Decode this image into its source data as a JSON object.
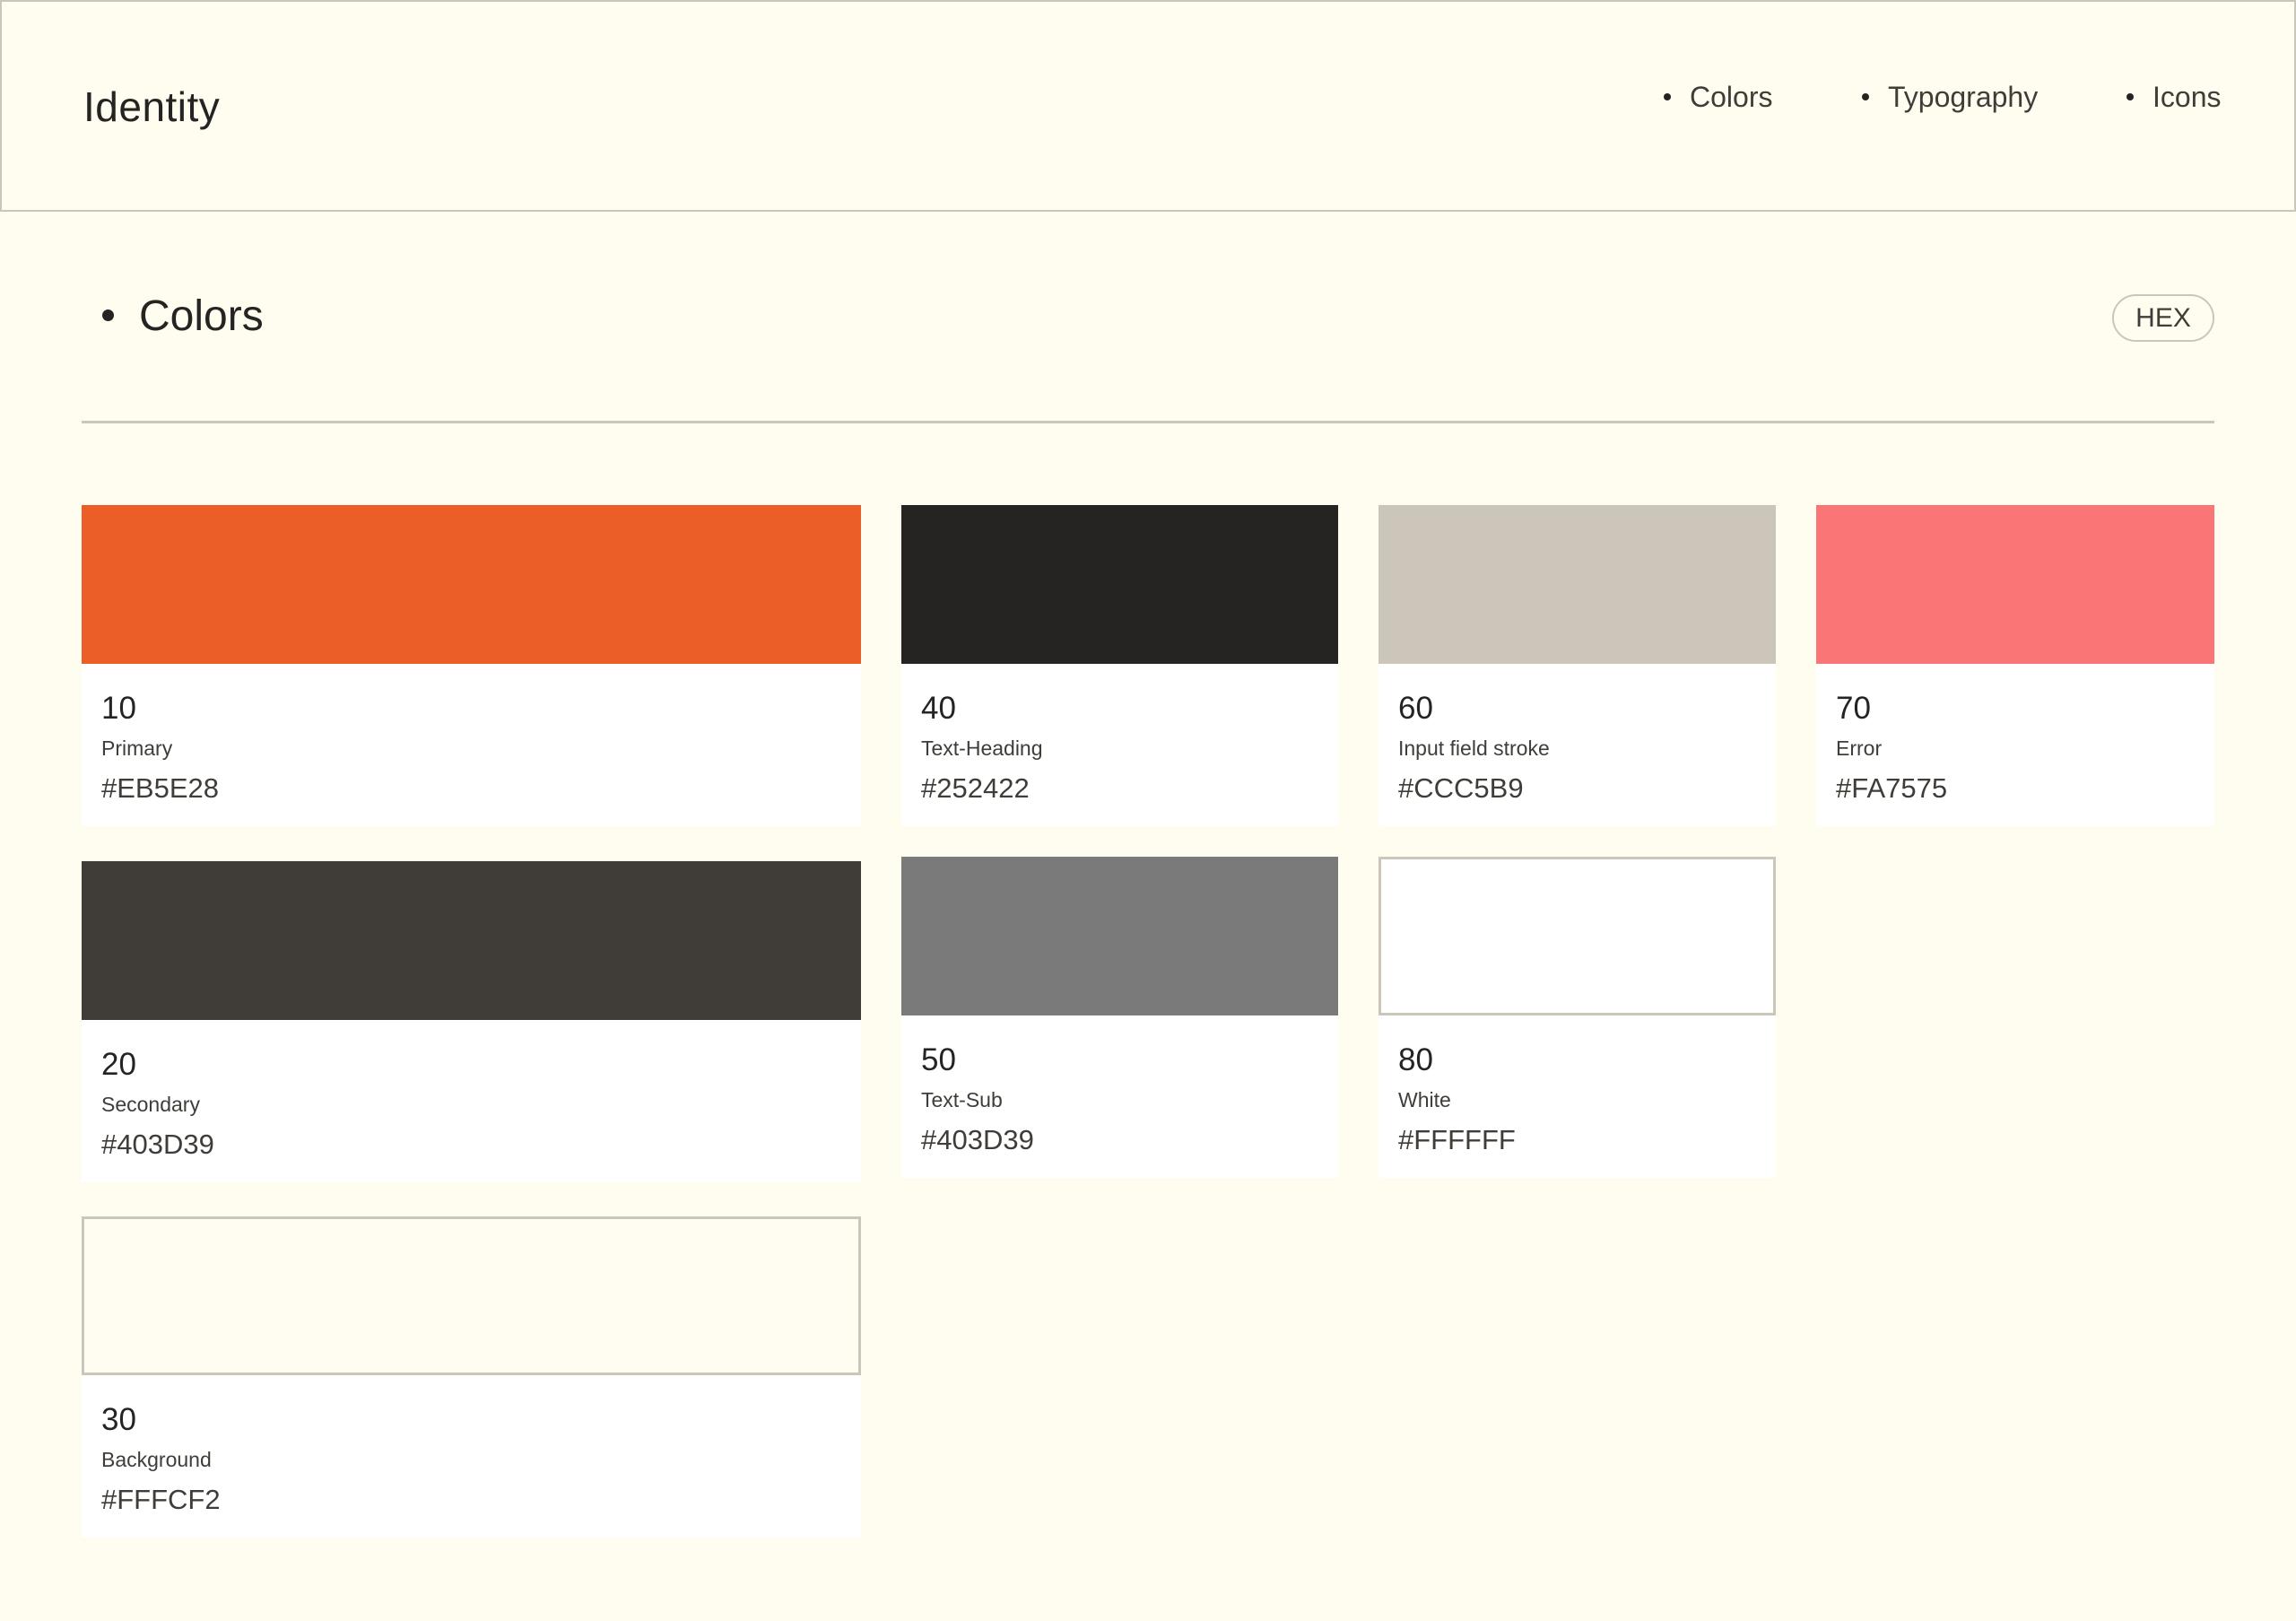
{
  "header": {
    "brand": "Identity",
    "nav": [
      "Colors",
      "Typography",
      "Icons"
    ]
  },
  "section": {
    "title": "Colors",
    "format_button": "HEX"
  },
  "colors": [
    {
      "num": "10",
      "name": "Primary",
      "hex": "#EB5E28",
      "swatch": "#EB5E28"
    },
    {
      "num": "20",
      "name": "Secondary",
      "hex": "#403D39",
      "swatch": "#403D39"
    },
    {
      "num": "30",
      "name": "Background",
      "hex": "#FFFCF2",
      "swatch": "#FFFCF2"
    },
    {
      "num": "40",
      "name": "Text-Heading",
      "hex": "#252422",
      "swatch": "#252422"
    },
    {
      "num": "50",
      "name": "Text-Sub",
      "hex": "#403D39",
      "swatch": "#7A7A7A"
    },
    {
      "num": "60",
      "name": "Input field stroke",
      "hex": "#CCC5B9",
      "swatch": "#CCC5B9"
    },
    {
      "num": "80",
      "name": "White",
      "hex": "#FFFFFF",
      "swatch": "#FFFFFF"
    },
    {
      "num": "70",
      "name": "Error",
      "hex": "#FA7575",
      "swatch": "#FA7575"
    }
  ]
}
